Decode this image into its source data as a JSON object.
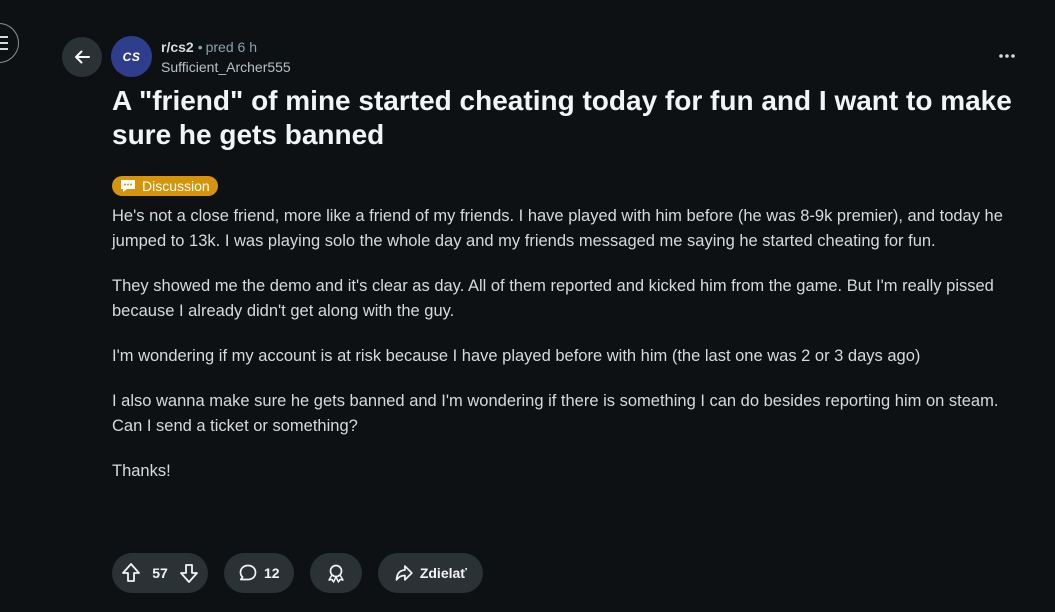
{
  "post": {
    "subreddit": "r/cs2",
    "subreddit_avatar_text": "CS",
    "separator": "•",
    "time": "pred 6 h",
    "author": "Sufficient_Archer555",
    "title": "A \"friend\" of mine started cheating today for fun and I want to make sure he gets banned",
    "flair": "Discussion",
    "body": [
      "He's not a close friend, more like a friend of my friends. I have played with him before (he was 8-9k premier), and today he jumped to 13k. I was playing solo the whole day and my friends messaged me saying he started cheating for fun.",
      "They showed me the demo and it's clear as day. All of them reported and kicked him from the game. But I'm really pissed because I already didn't get along with the guy.",
      "I'm wondering if my account is at risk because I have played before with him (the last one was 2 or 3 days ago)",
      "I also wanna make sure he gets banned and I'm wondering if there is something I can do besides reporting him on steam. Can I send a ticket or something?",
      "Thanks!"
    ]
  },
  "actions": {
    "upvotes": "57",
    "comments": "12",
    "share_label": "Zdielať"
  },
  "icons": {
    "edge": "menu-icon",
    "back": "arrow-left-icon",
    "more": "more-horizontal-icon",
    "flair": "speech-bubble-icon",
    "upvote": "arrow-up-icon",
    "downvote": "arrow-down-icon",
    "comment": "comment-icon",
    "award": "award-icon",
    "share": "share-icon"
  },
  "colors": {
    "background": "#0e1113",
    "button": "#2a3236",
    "flair": "#d4940c",
    "subreddit_avatar": "#2f3e8c"
  }
}
